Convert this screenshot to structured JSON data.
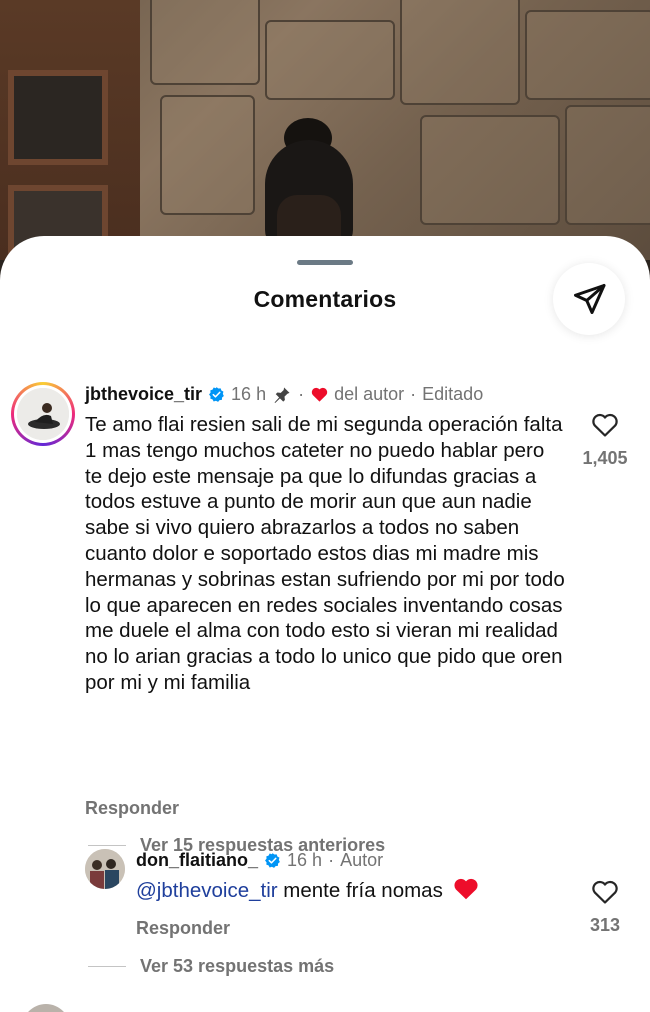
{
  "sheet": {
    "title": "Comentarios",
    "share_icon": "send-icon"
  },
  "comments": [
    {
      "username": "jbthevoice_tir",
      "verified": true,
      "time": "16 h",
      "pinned": true,
      "separator": "·",
      "author_like": "del autor",
      "edited": "Editado",
      "text": "Te amo flai resien sali de mi segunda operación falta 1 mas tengo muchos cateter no puedo hablar pero te dejo este mensaje pa que lo difundas gracias a todos estuve a punto de morir aun que aun nadie sabe si vivo quiero abrazarlos a todos no saben cuanto dolor e soportado estos dias mi madre mis hermanas y sobrinas estan sufriendo por mi por todo lo que aparecen en redes sociales inventando cosas me duele el alma con todo esto si vieran mi realidad no lo arian gracias a todo lo unico que pido que oren por mi y mi familia",
      "reply_label": "Responder",
      "likes": "1,405",
      "view_replies": "Ver 15 respuestas anteriores"
    }
  ],
  "replies": [
    {
      "username": "don_flaitiano_",
      "verified": true,
      "time": "16 h",
      "separator": "·",
      "role": "Autor",
      "mention": "@jbthevoice_tir",
      "text": " mente fría nomas",
      "emoji": "❤️",
      "reply_label": "Responder",
      "likes": "313",
      "view_more": "Ver 53 respuestas más"
    }
  ],
  "colors": {
    "verified_blue": "#0095f6",
    "heart_red": "#ed0d2a",
    "mention_blue": "#1f3f9c"
  }
}
